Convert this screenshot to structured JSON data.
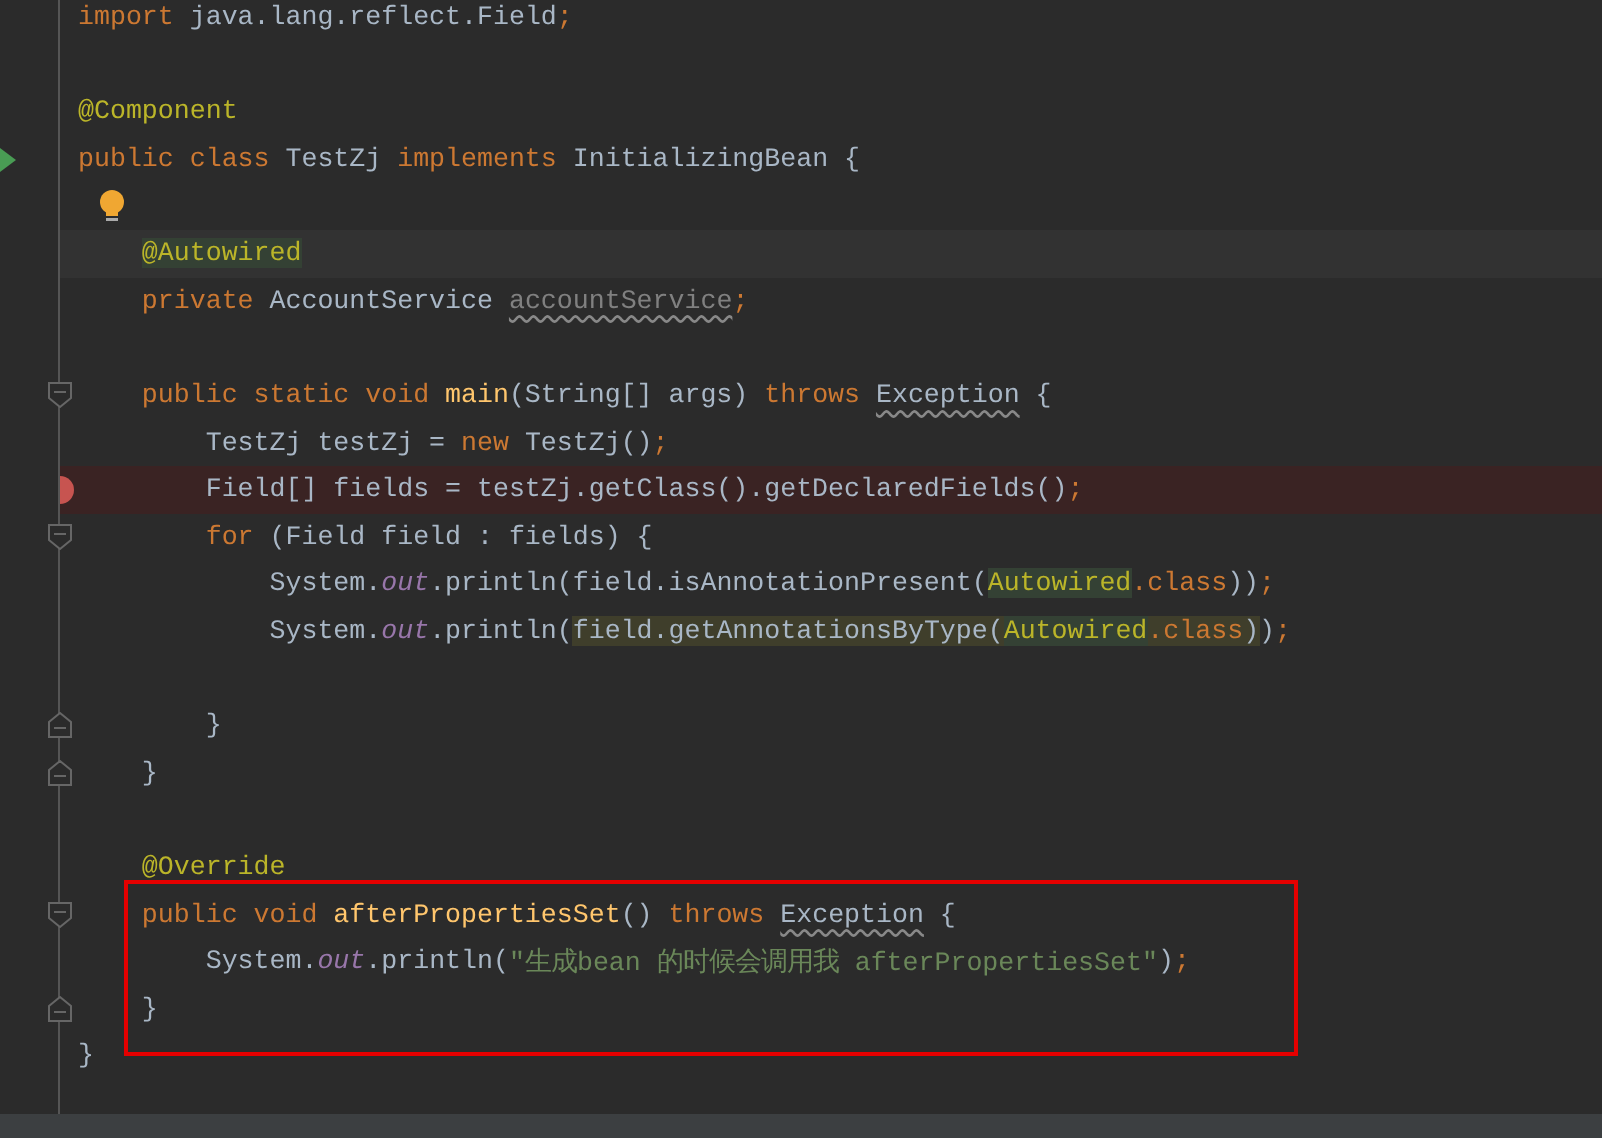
{
  "editor": {
    "lines": [
      {
        "tokens": [
          {
            "text": "import",
            "kind": "keyword"
          },
          {
            "text": " java.lang.reflect.Field",
            "kind": "plain"
          },
          {
            "text": ";",
            "kind": "punct"
          }
        ]
      },
      {
        "gap_before": true,
        "tokens": [
          {
            "text": "@Component",
            "kind": "annotation"
          }
        ]
      },
      {
        "run_marker": true,
        "tokens": [
          {
            "text": "public class ",
            "kind": "keyword"
          },
          {
            "text": "TestZj ",
            "kind": "plain"
          },
          {
            "text": "implements ",
            "kind": "keyword"
          },
          {
            "text": "InitializingBean {",
            "kind": "plain"
          }
        ]
      },
      {
        "bulb": true
      },
      {
        "current": true,
        "tokens": [
          {
            "text": "    @Autowired",
            "kind": "annotation",
            "usage_highlight": true
          }
        ]
      },
      {
        "tokens": [
          {
            "text": "    private ",
            "kind": "keyword"
          },
          {
            "text": "AccountService ",
            "kind": "plain"
          },
          {
            "text": "accountService",
            "kind": "unused"
          },
          {
            "text": ";",
            "kind": "punct"
          }
        ]
      },
      {
        "gap_before": true,
        "fold": true,
        "tokens": [
          {
            "text": "    public static void ",
            "kind": "keyword"
          },
          {
            "text": "main",
            "kind": "method"
          },
          {
            "text": "(String[] args) ",
            "kind": "plain"
          },
          {
            "text": "throws ",
            "kind": "keyword"
          },
          {
            "text": "Exception",
            "kind": "warned"
          },
          {
            "text": " {",
            "kind": "plain"
          }
        ]
      },
      {
        "tokens": [
          {
            "text": "        TestZj testZj = ",
            "kind": "plain"
          },
          {
            "text": "new ",
            "kind": "keyword"
          },
          {
            "text": "TestZj()",
            "kind": "plain"
          },
          {
            "text": ";",
            "kind": "punct"
          }
        ]
      },
      {
        "breakpoint": true,
        "tokens": [
          {
            "text": "        Field[] fields = testZj.getClass().getDeclaredFields()",
            "kind": "plain"
          },
          {
            "text": ";",
            "kind": "punct"
          }
        ]
      },
      {
        "fold": true,
        "tokens": [
          {
            "text": "        for ",
            "kind": "keyword"
          },
          {
            "text": "(Field field : fields) {",
            "kind": "plain"
          }
        ]
      },
      {
        "tokens": [
          {
            "text": "            System.",
            "kind": "plain"
          },
          {
            "text": "out",
            "kind": "static"
          },
          {
            "text": ".println(field.isAnnotationPresent(",
            "kind": "plain"
          },
          {
            "text": "Autowired",
            "kind": "annotation",
            "usage_highlight": true
          },
          {
            "text": ".class",
            "kind": "keyword"
          },
          {
            "text": "))",
            "kind": "plain"
          },
          {
            "text": ";",
            "kind": "punct"
          }
        ]
      },
      {
        "tokens": [
          {
            "text": "            System.",
            "kind": "plain"
          },
          {
            "text": "out",
            "kind": "static"
          },
          {
            "text": ".println(",
            "kind": "plain"
          },
          {
            "text": "field.getAnnotationsByType(",
            "kind": "plain",
            "match_highlight": true
          },
          {
            "text": "Autowired",
            "kind": "annotation",
            "usage_highlight": true
          },
          {
            "text": ".class",
            "kind": "keyword",
            "match_highlight": true
          },
          {
            "text": ")",
            "kind": "plain",
            "match_highlight": true
          },
          {
            "text": ")",
            "kind": "plain"
          },
          {
            "text": ";",
            "kind": "punct"
          }
        ]
      },
      {
        "gap_before": true,
        "fold_end": true,
        "tokens": [
          {
            "text": "        }",
            "kind": "plain"
          }
        ]
      },
      {
        "fold_end": true,
        "tokens": [
          {
            "text": "    }",
            "kind": "plain"
          }
        ]
      },
      {
        "gap_before": true,
        "tokens": [
          {
            "text": "    @Override",
            "kind": "annotation"
          }
        ]
      },
      {
        "fold": true,
        "boxed": true,
        "tokens": [
          {
            "text": "    public void ",
            "kind": "keyword"
          },
          {
            "text": "afterPropertiesSet",
            "kind": "method"
          },
          {
            "text": "() ",
            "kind": "plain"
          },
          {
            "text": "throws ",
            "kind": "keyword"
          },
          {
            "text": "Exception",
            "kind": "warned"
          },
          {
            "text": " {",
            "kind": "plain"
          }
        ]
      },
      {
        "boxed": true,
        "tokens": [
          {
            "text": "        System.",
            "kind": "plain"
          },
          {
            "text": "out",
            "kind": "static"
          },
          {
            "text": ".println(",
            "kind": "plain"
          },
          {
            "text": "\"生成bean 的时候会调用我 afterPropertiesSet\"",
            "kind": "string"
          },
          {
            "text": ")",
            "kind": "plain"
          },
          {
            "text": ";",
            "kind": "punct"
          }
        ]
      },
      {
        "fold_end": true,
        "boxed": true,
        "tokens": [
          {
            "text": "    }",
            "kind": "plain"
          }
        ]
      },
      {
        "tokens": [
          {
            "text": "}",
            "kind": "plain"
          }
        ]
      }
    ]
  }
}
